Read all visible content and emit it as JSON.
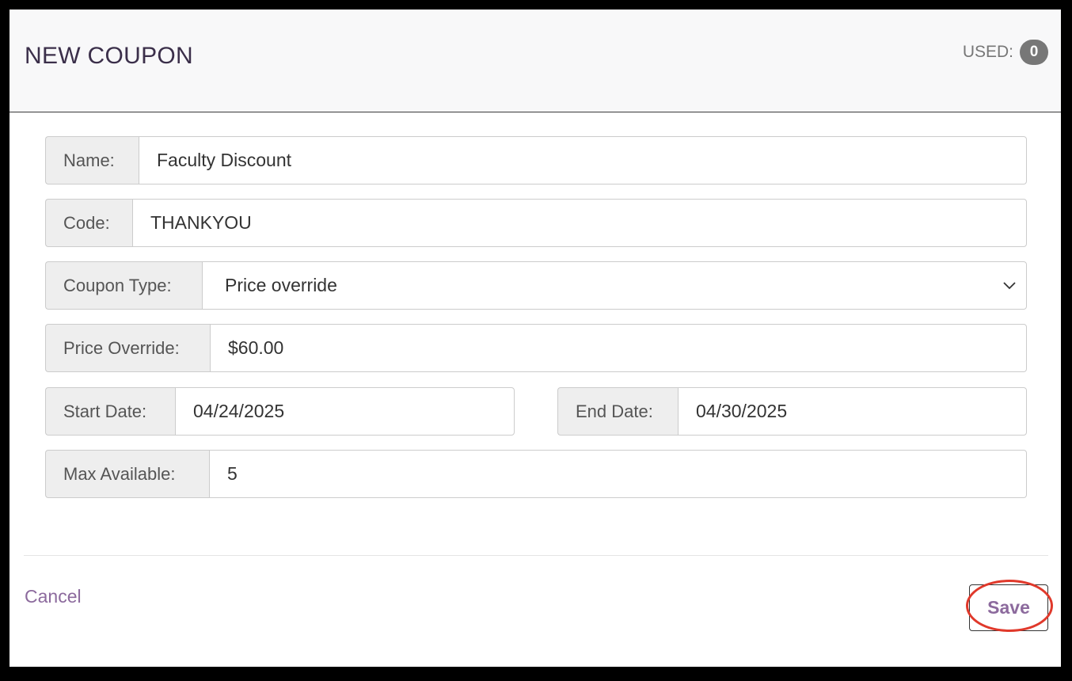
{
  "header": {
    "title": "NEW COUPON",
    "used_label": "USED:",
    "used_count": "0"
  },
  "form": {
    "name": {
      "label": "Name:",
      "value": "Faculty Discount"
    },
    "code": {
      "label": "Code:",
      "value": "THANKYOU"
    },
    "coupon_type": {
      "label": "Coupon Type:",
      "selected": "Price override"
    },
    "price_override": {
      "label": "Price Override:",
      "value": "$60.00"
    },
    "start_date": {
      "label": "Start Date:",
      "value": "04/24/2025"
    },
    "end_date": {
      "label": "End Date:",
      "value": "04/30/2025"
    },
    "max_available": {
      "label": "Max Available:",
      "value": "5"
    }
  },
  "footer": {
    "cancel_label": "Cancel",
    "save_label": "Save"
  },
  "colors": {
    "accent": "#8c6a9d",
    "highlight": "#e0392b",
    "badge": "#777777"
  },
  "icons": {
    "select_chevron": "chevron-down-icon"
  }
}
